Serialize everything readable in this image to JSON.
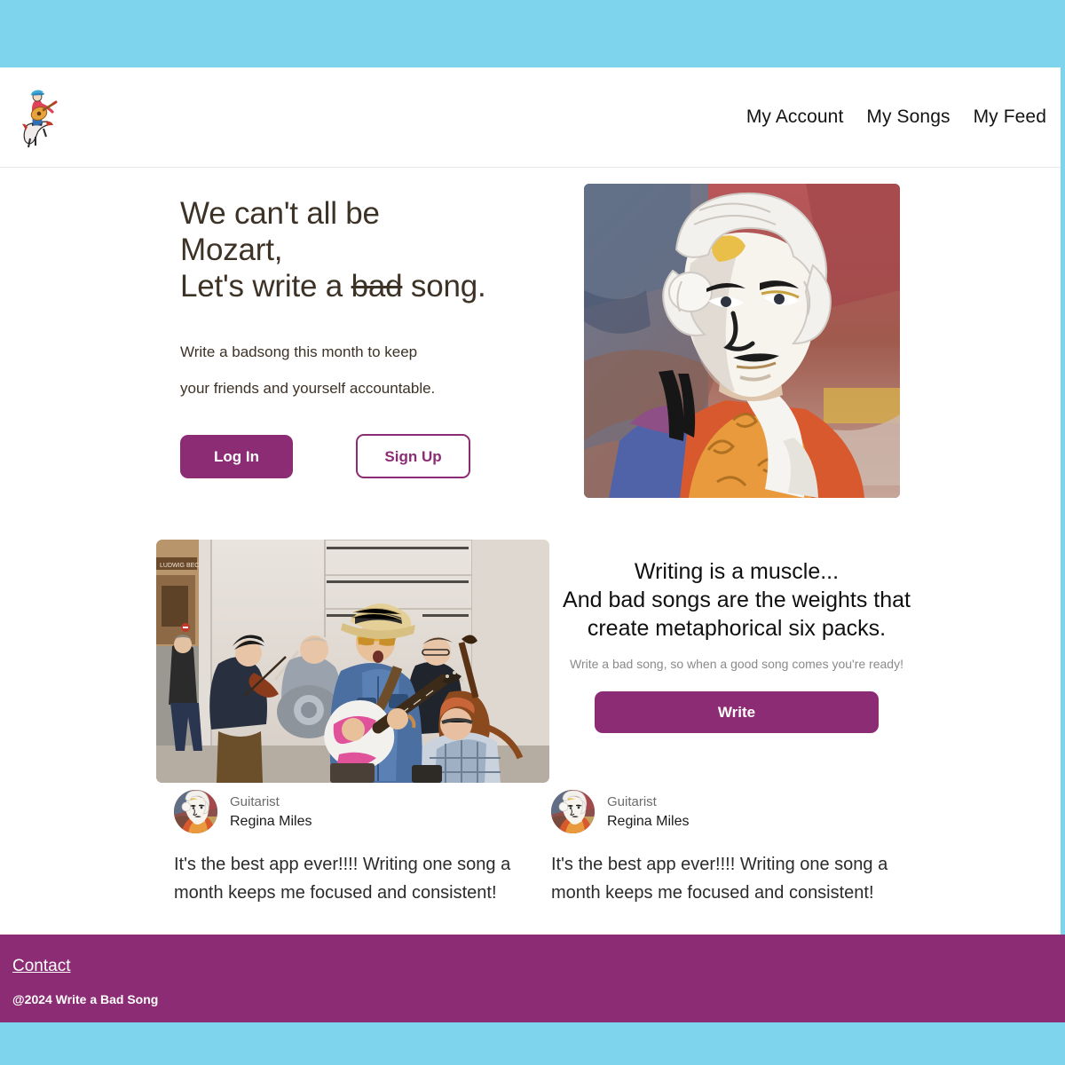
{
  "theme": {
    "accent_purple": "#8c2c74",
    "accent_blue": "#7ed4ec",
    "heading_brown": "#3d3226",
    "muted_gray": "#8a8a8a"
  },
  "header": {
    "logo_icon": "guitarist-on-horse-logo",
    "nav": [
      {
        "label": "My Account",
        "name": "nav-my-account"
      },
      {
        "label": "My Songs",
        "name": "nav-my-songs"
      },
      {
        "label": "My Feed",
        "name": "nav-my-feed"
      }
    ]
  },
  "hero": {
    "title": "We can't all be\nMozart,\nLet's write a ",
    "title_strike": "bad",
    "title_tail": " song.",
    "subtitle": "Write a badsong this month to keep\nyour friends and yourself accountable.",
    "login_label": "Log In",
    "signup_label": "Sign Up",
    "artwork_alt": "mozart-portrait-illustration"
  },
  "pitch": {
    "headline": "Writing is a muscle...\nAnd bad songs are the weights that\ncreate metaphorical six packs.",
    "subtext": "Write a bad song, so when a good song comes you're ready!",
    "write_label": "Write",
    "photo_alt": "street-band-performing-photo"
  },
  "testimonials": [
    {
      "role": "Guitarist",
      "name": "Regina Miles",
      "quote": "It's the best app ever!!!! Writing one song a month keeps me focused and consistent!",
      "avatar_alt": "mozart-avatar"
    },
    {
      "role": "Guitarist",
      "name": "Regina Miles",
      "quote": "It's the best app ever!!!! Writing one song a month keeps me focused and consistent!",
      "avatar_alt": "mozart-avatar"
    }
  ],
  "footer": {
    "contact_label": "Contact",
    "copyright": "@2024 Write a Bad Song"
  }
}
